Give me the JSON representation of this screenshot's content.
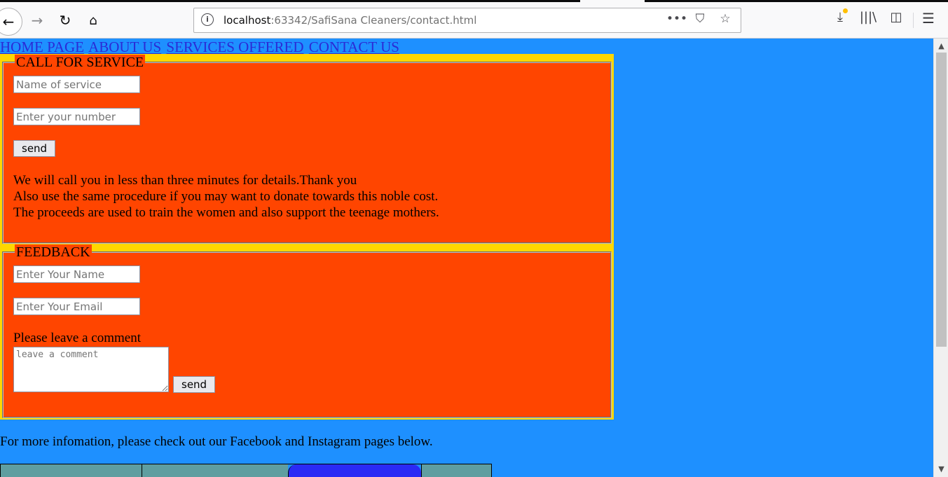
{
  "browser": {
    "url_host": "localhost",
    "url_rest": ":63342/SafiSana Cleaners/contact.html",
    "icons": {
      "back": "←",
      "forward": "→",
      "reload": "↻",
      "home": "⌂",
      "info": "i",
      "more": "•••",
      "pocket": "⛉",
      "bookmark": "☆",
      "download": "⤓",
      "library": "|||\\",
      "sidebar": "◫",
      "menu": "☰"
    }
  },
  "nav": {
    "items": [
      "HOME PAGE",
      "ABOUT US",
      "SERVICES OFFERED",
      "CONTACT US"
    ]
  },
  "call_section": {
    "legend": "CALL FOR SERVICE",
    "service_placeholder": "Name of service",
    "number_placeholder": "Enter your number",
    "send_label": "send",
    "lines": [
      "We will call you in less than three minutes for details.Thank you",
      "Also use the same procedure if you may want to donate towards this noble cost.",
      "The proceeds are used to train the women and also support the teenage mothers."
    ]
  },
  "feedback_section": {
    "legend": "FEEDBACK",
    "name_placeholder": "Enter Your Name",
    "email_placeholder": "Enter Your Email",
    "comment_label": "Please leave a comment",
    "comment_placeholder": "leave a comment",
    "send_label": "send"
  },
  "footer": {
    "more_info": "For more infomation, please check out our Facebook and Instagram pages below."
  },
  "colors": {
    "page_bg": "#1e90ff",
    "panel_border": "#ffd700",
    "fieldset_bg": "#ff4500",
    "link": "#2b2bd6",
    "bottom_bar": "#5f9ea0",
    "bottom_highlight": "#2a2af5"
  }
}
